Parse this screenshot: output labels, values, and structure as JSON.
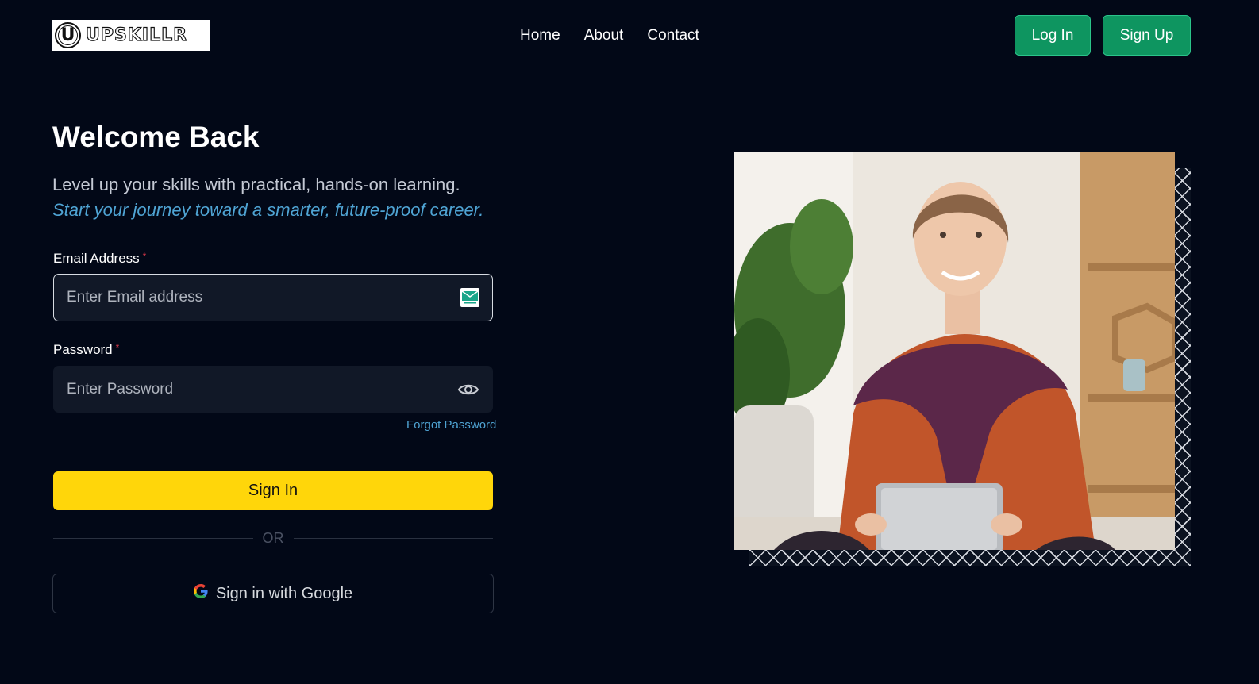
{
  "header": {
    "logo_letter": "U",
    "logo_text": "UPSKILLR",
    "nav": [
      {
        "label": "Home"
      },
      {
        "label": "About"
      },
      {
        "label": "Contact"
      }
    ],
    "login_label": "Log In",
    "signup_label": "Sign Up"
  },
  "main": {
    "title": "Welcome Back",
    "subtitle": "Level up your skills with practical, hands-on learning.",
    "tagline": "Start your journey toward a smarter, future-proof career.",
    "email": {
      "label": "Email Address",
      "required_mark": "*",
      "placeholder": "Enter Email address",
      "icon": "mail-icon"
    },
    "password": {
      "label": "Password",
      "required_mark": "*",
      "placeholder": "Enter Password",
      "icon": "eye-icon"
    },
    "forgot_label": "Forgot Password",
    "signin_label": "Sign In",
    "or_text": "OR",
    "google_label": "Sign in with Google"
  },
  "colors": {
    "background": "#020817",
    "accent_green": "#0e9560",
    "accent_yellow": "#ffd60a",
    "link_blue": "#4fa4d4"
  }
}
